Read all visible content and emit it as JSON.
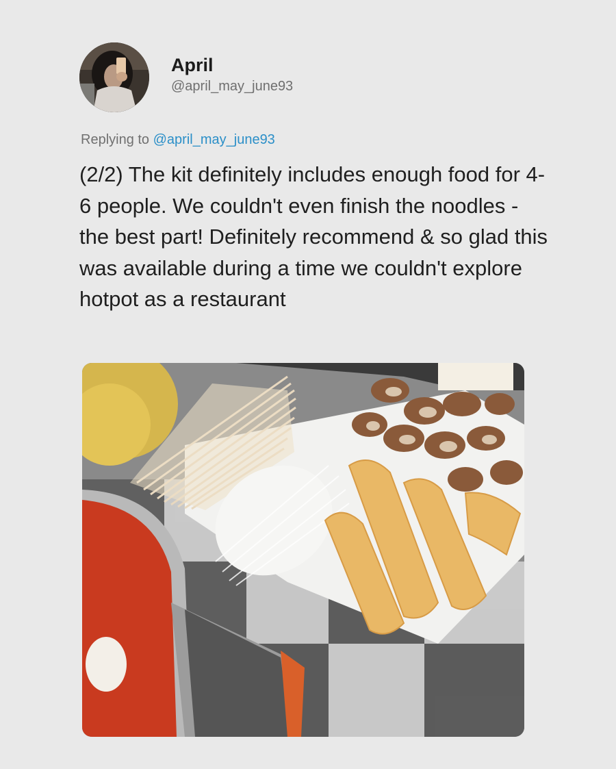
{
  "author": {
    "display_name": "April",
    "handle": "@april_may_june93"
  },
  "reply": {
    "prefix": "Replying to",
    "handle": "@april_may_june93"
  },
  "tweet": {
    "text": "(2/2) The kit definitely includes enough food for 4-6 people. We couldn't even finish the noodles - the best part! Definitely recommend & so glad this was available during a time we couldn't explore hotpot as a restaurant"
  },
  "colors": {
    "background": "#e9e9e9",
    "link": "#2b8fc8",
    "text": "#1f1f1f",
    "secondary_text": "#6f6f6f"
  }
}
